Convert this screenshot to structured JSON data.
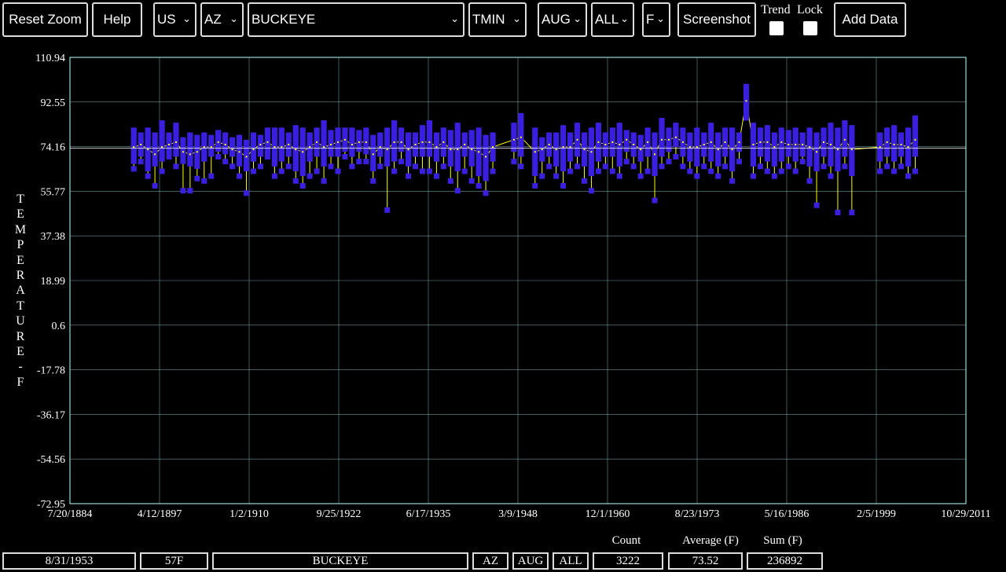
{
  "toolbar": {
    "reset_zoom": "Reset Zoom",
    "help": "Help",
    "country": "US",
    "state": "AZ",
    "station": "BUCKEYE",
    "element": "TMIN",
    "month": "AUG",
    "day": "ALL",
    "unit": "F",
    "screenshot": "Screenshot",
    "trend_label": "Trend",
    "lock_label": "Lock",
    "add_data": "Add Data"
  },
  "axis": {
    "ylabel_letters": [
      "T",
      "E",
      "M",
      "P",
      "E",
      "R",
      "A",
      "T",
      "U",
      "R",
      "E",
      "-",
      "F"
    ]
  },
  "colors": {
    "box": "#3a1fe0",
    "median": "#ffff00",
    "grid": "#9ad7d7",
    "mean_line": "#ffffff"
  },
  "chart_data": {
    "type": "box",
    "title": "",
    "xlabel": "",
    "ylabel": "TEMPERATURE - F",
    "ylim": [
      -72.95,
      110.94
    ],
    "xlim": [
      "1884-07-20",
      "2011-10-29"
    ],
    "y_ticks": [
      "110.94",
      "92.55",
      "74.16",
      "55.77",
      "37.38",
      "18.99",
      "0.6",
      "-17.78",
      "-36.17",
      "-54.56",
      "-72.95"
    ],
    "x_ticks": [
      "7/20/1884",
      "4/12/1897",
      "1/2/1910",
      "9/25/1922",
      "6/17/1935",
      "3/9/1948",
      "12/1/1960",
      "8/23/1973",
      "5/16/1986",
      "2/5/1999",
      "10/29/2011"
    ],
    "mean_line": 73.52,
    "grid": true,
    "series": [
      {
        "year": 1893,
        "min": 65,
        "q1": 67,
        "q3": 82,
        "max": 82,
        "median": 74
      },
      {
        "year": 1894,
        "min": 68,
        "q1": 70,
        "q3": 80,
        "max": 80,
        "median": 75
      },
      {
        "year": 1895,
        "min": 62,
        "q1": 64,
        "q3": 82,
        "max": 82,
        "median": 73
      },
      {
        "year": 1896,
        "min": 58,
        "q1": 66,
        "q3": 80,
        "max": 80,
        "median": 71
      },
      {
        "year": 1897,
        "min": 64,
        "q1": 68,
        "q3": 85,
        "max": 85,
        "median": 74
      },
      {
        "year": 1898,
        "min": 70,
        "q1": 71,
        "q3": 80,
        "max": 80,
        "median": 75
      },
      {
        "year": 1899,
        "min": 66,
        "q1": 70,
        "q3": 84,
        "max": 84,
        "median": 76
      },
      {
        "year": 1900,
        "min": 56,
        "q1": 67,
        "q3": 78,
        "max": 78,
        "median": 72
      },
      {
        "year": 1901,
        "min": 56,
        "q1": 66,
        "q3": 80,
        "max": 80,
        "median": 71
      },
      {
        "year": 1902,
        "min": 61,
        "q1": 65,
        "q3": 79,
        "max": 79,
        "median": 72
      },
      {
        "year": 1903,
        "min": 60,
        "q1": 68,
        "q3": 80,
        "max": 80,
        "median": 74
      },
      {
        "year": 1904,
        "min": 62,
        "q1": 70,
        "q3": 79,
        "max": 79,
        "median": 74
      },
      {
        "year": 1905,
        "min": 70,
        "q1": 72,
        "q3": 81,
        "max": 81,
        "median": 76
      },
      {
        "year": 1906,
        "min": 68,
        "q1": 71,
        "q3": 80,
        "max": 80,
        "median": 75
      },
      {
        "year": 1907,
        "min": 66,
        "q1": 70,
        "q3": 78,
        "max": 78,
        "median": 73
      },
      {
        "year": 1908,
        "min": 62,
        "q1": 66,
        "q3": 79,
        "max": 79,
        "median": 72
      },
      {
        "year": 1909,
        "min": 55,
        "q1": 64,
        "q3": 77,
        "max": 77,
        "median": 70
      },
      {
        "year": 1910,
        "min": 64,
        "q1": 68,
        "q3": 80,
        "max": 80,
        "median": 73
      },
      {
        "year": 1911,
        "min": 66,
        "q1": 70,
        "q3": 79,
        "max": 79,
        "median": 75
      },
      {
        "year": 1912,
        "min": 70,
        "q1": 71,
        "q3": 82,
        "max": 82,
        "median": 76
      },
      {
        "year": 1913,
        "min": 62,
        "q1": 66,
        "q3": 82,
        "max": 82,
        "median": 74
      },
      {
        "year": 1914,
        "min": 64,
        "q1": 68,
        "q3": 82,
        "max": 82,
        "median": 74
      },
      {
        "year": 1915,
        "min": 66,
        "q1": 70,
        "q3": 80,
        "max": 80,
        "median": 75
      },
      {
        "year": 1916,
        "min": 60,
        "q1": 64,
        "q3": 83,
        "max": 83,
        "median": 73
      },
      {
        "year": 1917,
        "min": 58,
        "q1": 62,
        "q3": 82,
        "max": 82,
        "median": 72
      },
      {
        "year": 1918,
        "min": 62,
        "q1": 68,
        "q3": 80,
        "max": 80,
        "median": 74
      },
      {
        "year": 1919,
        "min": 64,
        "q1": 70,
        "q3": 82,
        "max": 82,
        "median": 76
      },
      {
        "year": 1920,
        "min": 60,
        "q1": 66,
        "q3": 85,
        "max": 85,
        "median": 74
      },
      {
        "year": 1921,
        "min": 66,
        "q1": 70,
        "q3": 81,
        "max": 81,
        "median": 75
      },
      {
        "year": 1922,
        "min": 64,
        "q1": 70,
        "q3": 82,
        "max": 82,
        "median": 76
      },
      {
        "year": 1923,
        "min": 70,
        "q1": 72,
        "q3": 82,
        "max": 82,
        "median": 77
      },
      {
        "year": 1924,
        "min": 66,
        "q1": 70,
        "q3": 82,
        "max": 82,
        "median": 75
      },
      {
        "year": 1925,
        "min": 68,
        "q1": 72,
        "q3": 81,
        "max": 81,
        "median": 76
      },
      {
        "year": 1926,
        "min": 68,
        "q1": 71,
        "q3": 82,
        "max": 82,
        "median": 76
      },
      {
        "year": 1927,
        "min": 60,
        "q1": 64,
        "q3": 79,
        "max": 79,
        "median": 71
      },
      {
        "year": 1928,
        "min": 66,
        "q1": 70,
        "q3": 80,
        "max": 80,
        "median": 74
      },
      {
        "year": 1929,
        "min": 48,
        "q1": 66,
        "q3": 82,
        "max": 82,
        "median": 73
      },
      {
        "year": 1930,
        "min": 64,
        "q1": 68,
        "q3": 85,
        "max": 85,
        "median": 76
      },
      {
        "year": 1931,
        "min": 68,
        "q1": 72,
        "q3": 82,
        "max": 82,
        "median": 76
      },
      {
        "year": 1932,
        "min": 62,
        "q1": 66,
        "q3": 80,
        "max": 80,
        "median": 73
      },
      {
        "year": 1933,
        "min": 66,
        "q1": 70,
        "q3": 80,
        "max": 80,
        "median": 75
      },
      {
        "year": 1934,
        "min": 64,
        "q1": 70,
        "q3": 83,
        "max": 83,
        "median": 76
      },
      {
        "year": 1935,
        "min": 64,
        "q1": 70,
        "q3": 85,
        "max": 85,
        "median": 76
      },
      {
        "year": 1936,
        "min": 62,
        "q1": 68,
        "q3": 80,
        "max": 80,
        "median": 74
      },
      {
        "year": 1937,
        "min": 66,
        "q1": 70,
        "q3": 82,
        "max": 82,
        "median": 76
      },
      {
        "year": 1938,
        "min": 60,
        "q1": 66,
        "q3": 81,
        "max": 81,
        "median": 73
      },
      {
        "year": 1939,
        "min": 56,
        "q1": 64,
        "q3": 84,
        "max": 84,
        "median": 73
      },
      {
        "year": 1940,
        "min": 64,
        "q1": 70,
        "q3": 80,
        "max": 80,
        "median": 75
      },
      {
        "year": 1941,
        "min": 60,
        "q1": 66,
        "q3": 81,
        "max": 81,
        "median": 73
      },
      {
        "year": 1942,
        "min": 58,
        "q1": 62,
        "q3": 82,
        "max": 82,
        "median": 72
      },
      {
        "year": 1943,
        "min": 55,
        "q1": 60,
        "q3": 79,
        "max": 79,
        "median": 70
      },
      {
        "year": 1944,
        "min": 64,
        "q1": 68,
        "q3": 80,
        "max": 80,
        "median": 74
      },
      {
        "year": 1947,
        "min": 68,
        "q1": 72,
        "q3": 84,
        "max": 84,
        "median": 77
      },
      {
        "year": 1948,
        "min": 66,
        "q1": 70,
        "q3": 88,
        "max": 88,
        "median": 78
      },
      {
        "year": 1950,
        "min": 58,
        "q1": 62,
        "q3": 82,
        "max": 82,
        "median": 72
      },
      {
        "year": 1951,
        "min": 62,
        "q1": 68,
        "q3": 78,
        "max": 78,
        "median": 73
      },
      {
        "year": 1952,
        "min": 66,
        "q1": 70,
        "q3": 80,
        "max": 80,
        "median": 75
      },
      {
        "year": 1953,
        "min": 62,
        "q1": 66,
        "q3": 80,
        "max": 80,
        "median": 73
      },
      {
        "year": 1954,
        "min": 58,
        "q1": 64,
        "q3": 83,
        "max": 83,
        "median": 74
      },
      {
        "year": 1955,
        "min": 64,
        "q1": 68,
        "q3": 80,
        "max": 80,
        "median": 74
      },
      {
        "year": 1956,
        "min": 66,
        "q1": 70,
        "q3": 84,
        "max": 84,
        "median": 77
      },
      {
        "year": 1957,
        "min": 60,
        "q1": 66,
        "q3": 80,
        "max": 80,
        "median": 73
      },
      {
        "year": 1958,
        "min": 56,
        "q1": 62,
        "q3": 82,
        "max": 82,
        "median": 72
      },
      {
        "year": 1959,
        "min": 64,
        "q1": 68,
        "q3": 84,
        "max": 84,
        "median": 76
      },
      {
        "year": 1960,
        "min": 66,
        "q1": 70,
        "q3": 80,
        "max": 80,
        "median": 75
      },
      {
        "year": 1961,
        "min": 64,
        "q1": 70,
        "q3": 82,
        "max": 82,
        "median": 76
      },
      {
        "year": 1962,
        "min": 62,
        "q1": 66,
        "q3": 84,
        "max": 84,
        "median": 75
      },
      {
        "year": 1963,
        "min": 68,
        "q1": 72,
        "q3": 81,
        "max": 81,
        "median": 77
      },
      {
        "year": 1964,
        "min": 66,
        "q1": 70,
        "q3": 80,
        "max": 80,
        "median": 75
      },
      {
        "year": 1965,
        "min": 62,
        "q1": 68,
        "q3": 79,
        "max": 79,
        "median": 73
      },
      {
        "year": 1966,
        "min": 64,
        "q1": 70,
        "q3": 82,
        "max": 82,
        "median": 76
      },
      {
        "year": 1967,
        "min": 52,
        "q1": 62,
        "q3": 80,
        "max": 80,
        "median": 71
      },
      {
        "year": 1968,
        "min": 66,
        "q1": 70,
        "q3": 86,
        "max": 86,
        "median": 77
      },
      {
        "year": 1969,
        "min": 68,
        "q1": 72,
        "q3": 82,
        "max": 82,
        "median": 77
      },
      {
        "year": 1970,
        "min": 70,
        "q1": 74,
        "q3": 84,
        "max": 84,
        "median": 78
      },
      {
        "year": 1971,
        "min": 66,
        "q1": 70,
        "q3": 82,
        "max": 82,
        "median": 76
      },
      {
        "year": 1972,
        "min": 64,
        "q1": 68,
        "q3": 80,
        "max": 80,
        "median": 74
      },
      {
        "year": 1973,
        "min": 62,
        "q1": 66,
        "q3": 82,
        "max": 82,
        "median": 74
      },
      {
        "year": 1974,
        "min": 66,
        "q1": 70,
        "q3": 80,
        "max": 80,
        "median": 75
      },
      {
        "year": 1975,
        "min": 64,
        "q1": 68,
        "q3": 84,
        "max": 84,
        "median": 76
      },
      {
        "year": 1976,
        "min": 62,
        "q1": 66,
        "q3": 80,
        "max": 80,
        "median": 73
      },
      {
        "year": 1977,
        "min": 66,
        "q1": 70,
        "q3": 82,
        "max": 82,
        "median": 76
      },
      {
        "year": 1978,
        "min": 60,
        "q1": 64,
        "q3": 82,
        "max": 82,
        "median": 73
      },
      {
        "year": 1979,
        "min": 68,
        "q1": 72,
        "q3": 80,
        "max": 80,
        "median": 76
      },
      {
        "year": 1980,
        "min": 86,
        "q1": 86,
        "q3": 100,
        "max": 100,
        "median": 93
      },
      {
        "year": 1981,
        "min": 62,
        "q1": 66,
        "q3": 84,
        "max": 84,
        "median": 75
      },
      {
        "year": 1982,
        "min": 66,
        "q1": 70,
        "q3": 82,
        "max": 82,
        "median": 76
      },
      {
        "year": 1983,
        "min": 64,
        "q1": 68,
        "q3": 83,
        "max": 83,
        "median": 76
      },
      {
        "year": 1984,
        "min": 62,
        "q1": 66,
        "q3": 80,
        "max": 80,
        "median": 74
      },
      {
        "year": 1985,
        "min": 64,
        "q1": 68,
        "q3": 82,
        "max": 82,
        "median": 76
      },
      {
        "year": 1986,
        "min": 66,
        "q1": 70,
        "q3": 81,
        "max": 81,
        "median": 75
      },
      {
        "year": 1987,
        "min": 64,
        "q1": 68,
        "q3": 82,
        "max": 82,
        "median": 75
      },
      {
        "year": 1988,
        "min": 68,
        "q1": 70,
        "q3": 80,
        "max": 80,
        "median": 75
      },
      {
        "year": 1989,
        "min": 60,
        "q1": 66,
        "q3": 82,
        "max": 82,
        "median": 74
      },
      {
        "year": 1990,
        "min": 50,
        "q1": 64,
        "q3": 80,
        "max": 80,
        "median": 72
      },
      {
        "year": 1991,
        "min": 66,
        "q1": 70,
        "q3": 82,
        "max": 82,
        "median": 76
      },
      {
        "year": 1992,
        "min": 62,
        "q1": 66,
        "q3": 84,
        "max": 84,
        "median": 75
      },
      {
        "year": 1993,
        "min": 47,
        "q1": 64,
        "q3": 82,
        "max": 82,
        "median": 73
      },
      {
        "year": 1994,
        "min": 66,
        "q1": 70,
        "q3": 85,
        "max": 85,
        "median": 77
      },
      {
        "year": 1995,
        "min": 47,
        "q1": 62,
        "q3": 83,
        "max": 83,
        "median": 73
      },
      {
        "year": 1999,
        "min": 64,
        "q1": 68,
        "q3": 80,
        "max": 80,
        "median": 74
      },
      {
        "year": 2000,
        "min": 66,
        "q1": 70,
        "q3": 82,
        "max": 82,
        "median": 76
      },
      {
        "year": 2001,
        "min": 64,
        "q1": 68,
        "q3": 83,
        "max": 83,
        "median": 75
      },
      {
        "year": 2002,
        "min": 66,
        "q1": 70,
        "q3": 80,
        "max": 80,
        "median": 75
      },
      {
        "year": 2003,
        "min": 62,
        "q1": 66,
        "q3": 82,
        "max": 82,
        "median": 74
      },
      {
        "year": 2004,
        "min": 64,
        "q1": 70,
        "q3": 87,
        "max": 87,
        "median": 77
      }
    ]
  },
  "status": {
    "date": "8/31/1953",
    "value": "57F",
    "station": "BUCKEYE",
    "state": "AZ",
    "month": "AUG",
    "day": "ALL",
    "count_label": "Count",
    "count": "3222",
    "average_label": "Average (F)",
    "average": "73.52",
    "sum_label": "Sum (F)",
    "sum": "236892"
  }
}
